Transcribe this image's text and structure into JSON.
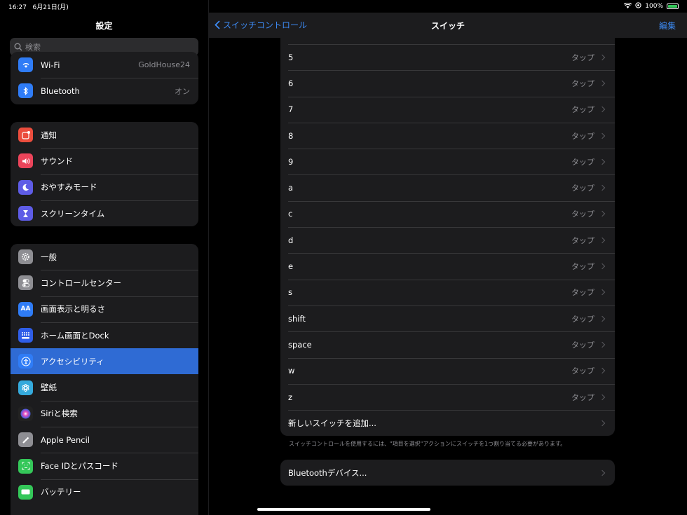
{
  "status": {
    "time": "16:27",
    "date": "6月21日(月)",
    "battery": "100%"
  },
  "sidebar": {
    "title": "設定",
    "search_placeholder": "検索",
    "group1": [
      {
        "label": "Wi-Fi",
        "value": "GoldHouse24",
        "icon": "wifi-icon",
        "color": "#2f7cf6"
      },
      {
        "label": "Bluetooth",
        "value": "オン",
        "icon": "bluetooth-icon",
        "color": "#2f7cf6"
      }
    ],
    "group2": [
      {
        "label": "通知",
        "icon": "notifications-icon",
        "color": "#eb4d3d"
      },
      {
        "label": "サウンド",
        "icon": "sound-icon",
        "color": "#eb445a"
      },
      {
        "label": "おやすみモード",
        "icon": "moon-icon",
        "color": "#5e5ce6"
      },
      {
        "label": "スクリーンタイム",
        "icon": "hourglass-icon",
        "color": "#5e5ce6"
      }
    ],
    "group3": [
      {
        "label": "一般",
        "icon": "gear-icon",
        "color": "#8e8e93"
      },
      {
        "label": "コントロールセンター",
        "icon": "toggles-icon",
        "color": "#8e8e93"
      },
      {
        "label": "画面表示と明るさ",
        "icon": "aa-icon",
        "color": "#2f7cf6"
      },
      {
        "label": "ホーム画面とDock",
        "icon": "home-grid-icon",
        "color": "#2f5ee8"
      },
      {
        "label": "アクセシビリティ",
        "icon": "accessibility-icon",
        "color": "#2f7cf6",
        "selected": true
      },
      {
        "label": "壁紙",
        "icon": "flower-icon",
        "color": "#35aadc"
      },
      {
        "label": "Siriと検索",
        "icon": "siri-icon",
        "color": "#222"
      },
      {
        "label": "Apple Pencil",
        "icon": "pencil-icon",
        "color": "#8e8e93"
      },
      {
        "label": "Face IDとパスコード",
        "icon": "faceid-icon",
        "color": "#34c759"
      },
      {
        "label": "バッテリー",
        "icon": "battery-icon",
        "color": "#34c759"
      }
    ]
  },
  "nav": {
    "back": "スイッチコントロール",
    "title": "スイッチ",
    "edit": "編集"
  },
  "switches": [
    {
      "key": "5",
      "action": "タップ"
    },
    {
      "key": "6",
      "action": "タップ"
    },
    {
      "key": "7",
      "action": "タップ"
    },
    {
      "key": "8",
      "action": "タップ"
    },
    {
      "key": "9",
      "action": "タップ"
    },
    {
      "key": "a",
      "action": "タップ"
    },
    {
      "key": "c",
      "action": "タップ"
    },
    {
      "key": "d",
      "action": "タップ"
    },
    {
      "key": "e",
      "action": "タップ"
    },
    {
      "key": "s",
      "action": "タップ"
    },
    {
      "key": "shift",
      "action": "タップ"
    },
    {
      "key": "space",
      "action": "タップ"
    },
    {
      "key": "w",
      "action": "タップ"
    },
    {
      "key": "z",
      "action": "タップ"
    }
  ],
  "add_switch": "新しいスイッチを追加...",
  "footnote": "スイッチコントロールを使用するには、\"項目を選択\"アクションにスイッチを1つ割り当てる必要があります。",
  "bluetooth_devices": "Bluetoothデバイス..."
}
